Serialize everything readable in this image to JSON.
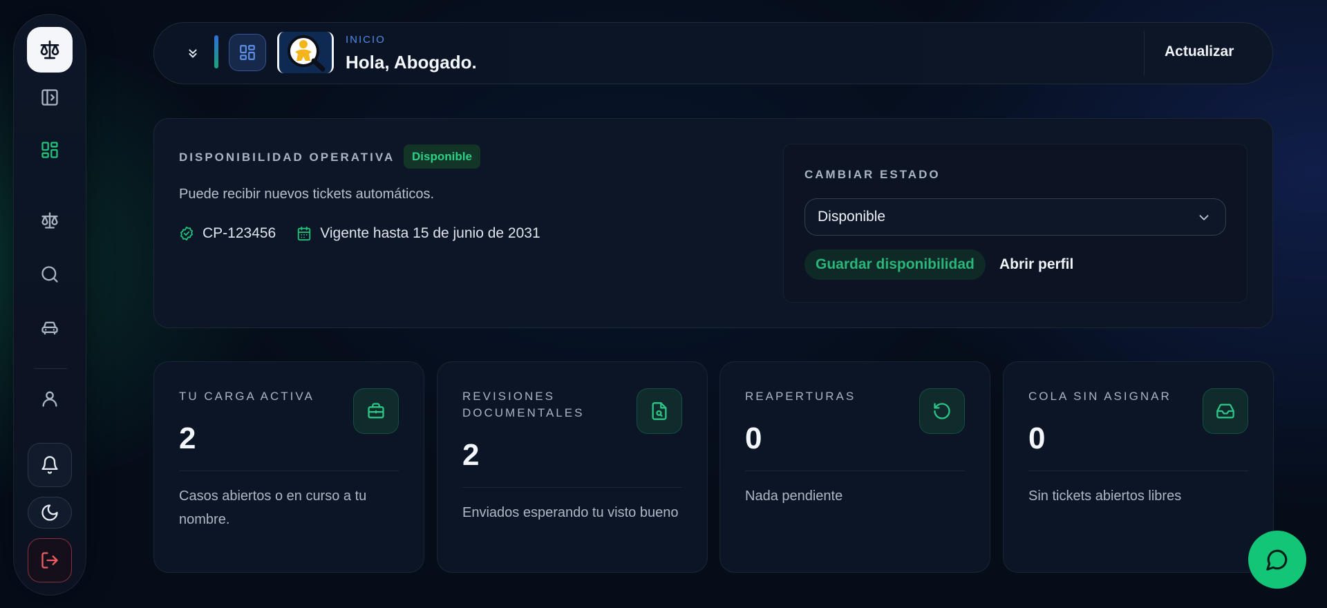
{
  "sidebar": {
    "items": [
      {
        "name": "logo",
        "icon": "scale-icon"
      },
      {
        "name": "toggle-sidebar",
        "icon": "panel-right-icon"
      },
      {
        "name": "dashboard",
        "icon": "grid-icon"
      },
      {
        "name": "cases",
        "icon": "scale-icon"
      },
      {
        "name": "search",
        "icon": "search-icon"
      },
      {
        "name": "vehicles",
        "icon": "car-icon"
      },
      {
        "name": "profile",
        "icon": "user-icon"
      },
      {
        "name": "notifications",
        "icon": "bell-icon"
      },
      {
        "name": "theme",
        "icon": "moon-icon"
      },
      {
        "name": "logout",
        "icon": "logout-icon"
      }
    ]
  },
  "header": {
    "eyebrow": "INICIO",
    "title": "Hola, Abogado.",
    "refresh_label": "Actualizar"
  },
  "availability": {
    "label": "DISPONIBILIDAD OPERATIVA",
    "badge": "Disponible",
    "description": "Puede recibir nuevos tickets automáticos.",
    "license": "CP-123456",
    "valid_until": "Vigente hasta 15 de junio de 2031",
    "panel": {
      "label": "CAMBIAR ESTADO",
      "selected": "Disponible",
      "save_label": "Guardar disponibilidad",
      "profile_label": "Abrir perfil"
    }
  },
  "stats": [
    {
      "label": "TU CARGA ACTIVA",
      "value": "2",
      "description": "Casos abiertos o en curso a tu nombre.",
      "icon": "briefcase-icon"
    },
    {
      "label": "REVISIONES DOCUMENTALES",
      "value": "2",
      "description": "Enviados esperando tu visto bueno",
      "icon": "file-search-icon"
    },
    {
      "label": "REAPERTURAS",
      "value": "0",
      "description": "Nada pendiente",
      "icon": "rotate-ccw-icon"
    },
    {
      "label": "COLA SIN ASIGNAR",
      "value": "0",
      "description": "Sin tickets abiertos libres",
      "icon": "inbox-icon"
    }
  ],
  "colors": {
    "accent_green": "#22c27a",
    "accent_blue": "#4f8ae8",
    "danger": "#ef5d64",
    "background": "#050d19"
  }
}
